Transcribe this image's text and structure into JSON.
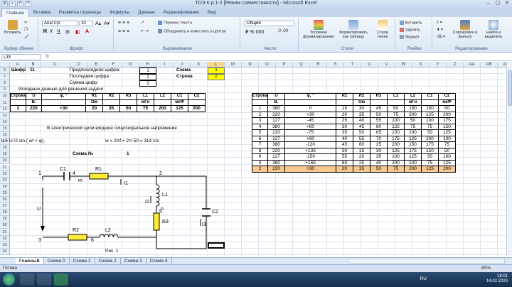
{
  "window": {
    "title": "ТОЭ К.р.1-2  [Режим совместимости] - Microsoft Excel"
  },
  "tabs": [
    "Главная",
    "Вставка",
    "Разметка страницы",
    "Формулы",
    "Данные",
    "Рецензирование",
    "Вид"
  ],
  "ribbon": {
    "paste": "Вставить",
    "clipboard_group": "Буфер обмена",
    "font_name": "Arial Cyr",
    "font_size": "10",
    "font_group": "Шрифт",
    "wrap_text": "Перенос текста",
    "merge_center": "Объединить и поместить в центре",
    "alignment_group": "Выравнивание",
    "number_format": "Общий",
    "number_group": "Число",
    "cond_format": "Условное форматирование",
    "format_table": "Форматировать как таблицу",
    "cell_styles": "Стили ячеек",
    "styles_group": "Стили",
    "insert": "Вставить",
    "delete": "Удалить",
    "format": "Формат",
    "cells_group": "Ячейки",
    "sort_filter": "Сортировка и фильтр",
    "find_select": "Найти и выделить",
    "editing_group": "Редактирование"
  },
  "formula_bar": {
    "name_box": "L33",
    "fx": "fx"
  },
  "columns": [
    "A",
    "B",
    "C",
    "D",
    "E",
    "F",
    "G",
    "H",
    "I",
    "J",
    "K",
    "L",
    "M",
    "N",
    "O",
    "P",
    "Q",
    "R",
    "S",
    "T",
    "U",
    "V",
    "W",
    "X",
    "Y",
    "Z",
    "AA",
    "AB",
    "AC",
    "AD"
  ],
  "rows": [
    "6",
    "7",
    "8",
    "9",
    "10",
    "11",
    "12",
    "13",
    "14",
    "15",
    "16",
    "17",
    "18",
    "19",
    "20",
    "21",
    "22",
    "23",
    "24",
    "25",
    "26",
    "27",
    "28",
    "29",
    "30",
    "31",
    "32",
    "33",
    "34"
  ],
  "sheet": {
    "cipher_label": "Шифр",
    "cipher_value": "11",
    "penult_label": "Предпоследняя цифра:",
    "penult_value": "1",
    "last_label": "Последняя цифра:",
    "last_value": "1",
    "sum_label": "Сумма цифр:",
    "sum_value": "2",
    "scheme_label": "Схема",
    "scheme_value": "1",
    "row_label": "Строка",
    "row_value": "2",
    "input_title": "Исходные данные для решения задачи",
    "circuit_text": "В электрической цепи входное синусоидальное напряжение",
    "formula_u": "u = U√2 sin ( wt + φ),",
    "formula_w": "w = 2πf =   2π·50 =   314 1/c",
    "scheme_no_label": "Схема №",
    "scheme_no_value": "1",
    "fig_caption": "Рис. 1"
  },
  "table1": {
    "headers": [
      "Строка",
      "U",
      "φ, °",
      "R1",
      "R2",
      "R3",
      "L1",
      "L2",
      "C1",
      "C2"
    ],
    "units": [
      "",
      "В.",
      "",
      "Ом",
      "",
      "",
      "мГн",
      "",
      "мкФ",
      ""
    ],
    "row": [
      "2",
      "220",
      "+30",
      "20",
      "35",
      "50",
      "75",
      "200",
      "125",
      "200"
    ]
  },
  "table2": {
    "headers": [
      "Строка",
      "U",
      "φ, °",
      "R1",
      "R2",
      "R3",
      "L1",
      "L2",
      "C1",
      "C2"
    ],
    "units": [
      "",
      "В.",
      "",
      "",
      "Ом",
      "",
      "",
      "мГн",
      "",
      "мкФ"
    ],
    "rows": [
      [
        "1",
        "380",
        "0",
        "15",
        "30",
        "45",
        "50",
        "150",
        "150",
        "50"
      ],
      [
        "2",
        "220",
        "+30",
        "20",
        "35",
        "50",
        "75",
        "200",
        "125",
        "200"
      ],
      [
        "3",
        "127",
        "-45",
        "25",
        "40",
        "55",
        "100",
        "50",
        "100",
        "175"
      ],
      [
        "4",
        "380",
        "+60",
        "30",
        "45",
        "60",
        "125",
        "75",
        "75",
        "150"
      ],
      [
        "5",
        "220",
        "-75",
        "35",
        "50",
        "65",
        "150",
        "100",
        "50",
        "125"
      ],
      [
        "6",
        "127",
        "+90",
        "40",
        "55",
        "70",
        "175",
        "125",
        "200",
        "100"
      ],
      [
        "7",
        "380",
        "-120",
        "45",
        "60",
        "25",
        "200",
        "150",
        "175",
        "75"
      ],
      [
        "8",
        "220",
        "+135",
        "50",
        "15",
        "30",
        "125",
        "175",
        "150",
        "50"
      ],
      [
        "9",
        "127",
        "-150",
        "55",
        "20",
        "35",
        "100",
        "125",
        "50",
        "100"
      ],
      [
        "0",
        "380",
        "+165",
        "60",
        "25",
        "40",
        "200",
        "100",
        "75",
        "125"
      ],
      [
        "2",
        "220",
        "+30",
        "20",
        "35",
        "50",
        "75",
        "200",
        "125",
        "200"
      ]
    ]
  },
  "circuit": {
    "labels": [
      "C1",
      "R1",
      "L1",
      "C2",
      "R3",
      "R2",
      "L2",
      "U",
      "I1",
      "I2",
      "I3",
      "m",
      "n",
      "1",
      "2",
      "3",
      "4",
      "5",
      "6"
    ]
  },
  "sheet_tabs": [
    "Главный",
    "Схема 0",
    "Схема 1",
    "Схема 2",
    "Схема 3",
    "Схема 4"
  ],
  "status": {
    "text": "Готово",
    "zoom": "80%"
  },
  "taskbar": {
    "lang": "RU",
    "time": "18:01",
    "date": "14.02.2020"
  }
}
